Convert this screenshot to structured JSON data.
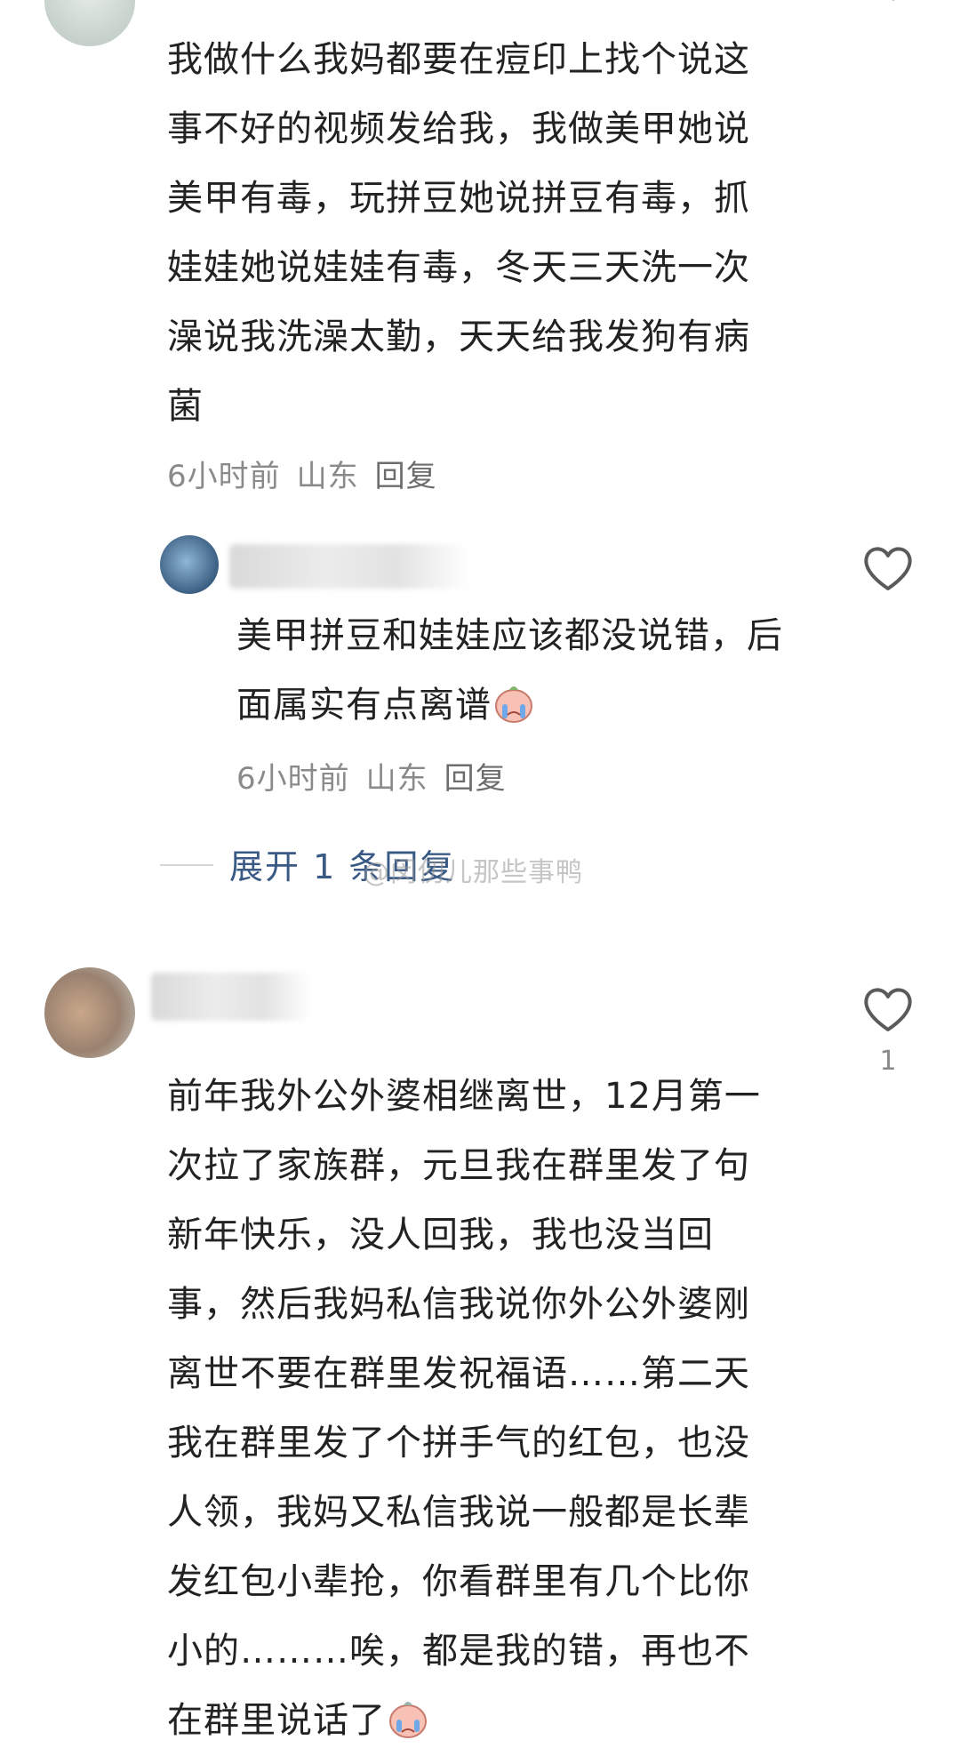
{
  "comments": [
    {
      "text_lines": [
        "我做什么我妈都要在痘印上找个说这",
        "事不好的视频发给我，我做美甲她说",
        "美甲有毒，玩拼豆她说拼豆有毒，抓",
        "娃娃她说娃娃有毒，冬天三天洗一次",
        "澡说我洗澡太勤，天天给我发狗有病",
        "菌"
      ],
      "time": "6小时前",
      "location": "山东",
      "reply_label": "回复"
    },
    {
      "text_lines": [
        "美甲拼豆和娃娃应该都没说错，后",
        "面属实有点离谱"
      ],
      "time": "6小时前",
      "location": "山东",
      "reply_label": "回复"
    },
    {
      "text_lines": [
        "前年我外公外婆相继离世，12月第一",
        "次拉了家族群，元旦我在群里发了句",
        "新年快乐，没人回我，我也没当回",
        "事，然后我妈私信我说你外公外婆刚",
        "离世不要在群里发祝福语……第二天",
        "我在群里发了个拼手气的红包，也没",
        "人领，我妈又私信我说一般都是长辈",
        "发红包小辈抢，你看群里有几个比你",
        "小的………唉，都是我的错，再也不",
        "在群里说话了"
      ],
      "like_count": "1"
    }
  ],
  "expand_replies": "展开 1 条回复",
  "watermark": "@闵仞儿那些事鸭",
  "icons": {
    "heart": "heart-outline-icon",
    "chevron": "chevron-down-icon",
    "emoji": "crying-face-emoji-icon"
  },
  "colors": {
    "text": "#222222",
    "meta": "#8a8a8a",
    "link": "#3a5a86"
  }
}
